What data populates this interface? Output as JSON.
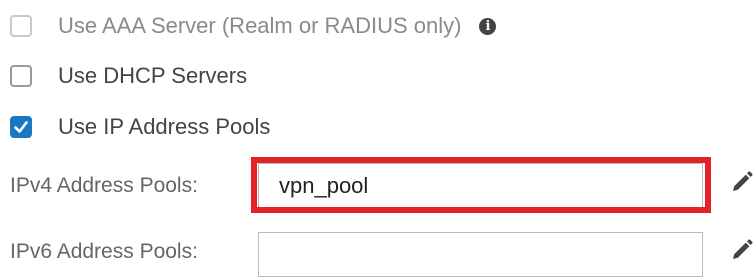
{
  "options": {
    "aaa": {
      "label": "Use AAA Server (Realm or RADIUS only)",
      "checked": false,
      "disabled": true,
      "info_icon": "info-icon"
    },
    "dhcp": {
      "label": "Use DHCP Servers",
      "checked": false
    },
    "ip_pools": {
      "label": "Use IP Address Pools",
      "checked": true
    }
  },
  "fields": {
    "ipv4": {
      "label": "IPv4 Address Pools:",
      "value": "vpn_pool",
      "edit_icon": "pencil-icon"
    },
    "ipv6": {
      "label": "IPv6 Address Pools:",
      "value": "",
      "edit_icon": "pencil-icon"
    }
  },
  "colors": {
    "accent": "#1a78c2",
    "highlight": "#e32128"
  }
}
